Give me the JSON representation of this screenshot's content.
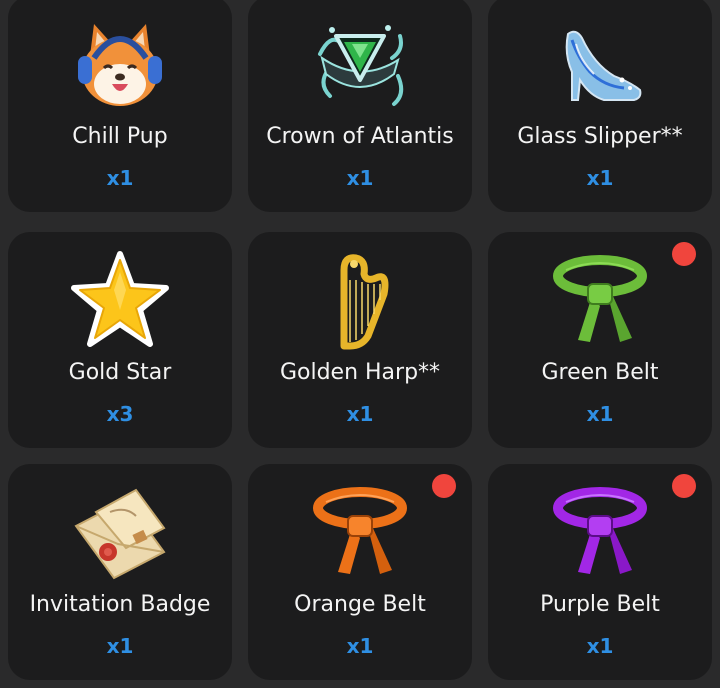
{
  "items": [
    {
      "name": "Chill Pup",
      "qty": "x1",
      "icon": "chill-pup-icon",
      "new_badge": false
    },
    {
      "name": "Crown of Atlantis",
      "qty": "x1",
      "icon": "crown-of-atlantis-icon",
      "new_badge": false
    },
    {
      "name": "Glass Slipper**",
      "qty": "x1",
      "icon": "glass-slipper-icon",
      "new_badge": false
    },
    {
      "name": "Gold Star",
      "qty": "x3",
      "icon": "gold-star-icon",
      "new_badge": false
    },
    {
      "name": "Golden Harp**",
      "qty": "x1",
      "icon": "golden-harp-icon",
      "new_badge": false
    },
    {
      "name": "Green Belt",
      "qty": "x1",
      "icon": "green-belt-icon",
      "new_badge": true
    },
    {
      "name": "Invitation Badge",
      "qty": "x1",
      "icon": "invitation-badge-icon",
      "new_badge": false
    },
    {
      "name": "Orange Belt",
      "qty": "x1",
      "icon": "orange-belt-icon",
      "new_badge": true
    },
    {
      "name": "Purple Belt",
      "qty": "x1",
      "icon": "purple-belt-icon",
      "new_badge": true
    }
  ],
  "colors": {
    "background": "#2a2a2b",
    "card": "#1c1c1d",
    "name_text": "#f4f4f4",
    "quantity_text": "#2f8fe3",
    "notification_dot": "#f0453d",
    "green_belt": "#6cbd3a",
    "orange_belt": "#ec7118",
    "purple_belt": "#a227e6"
  }
}
